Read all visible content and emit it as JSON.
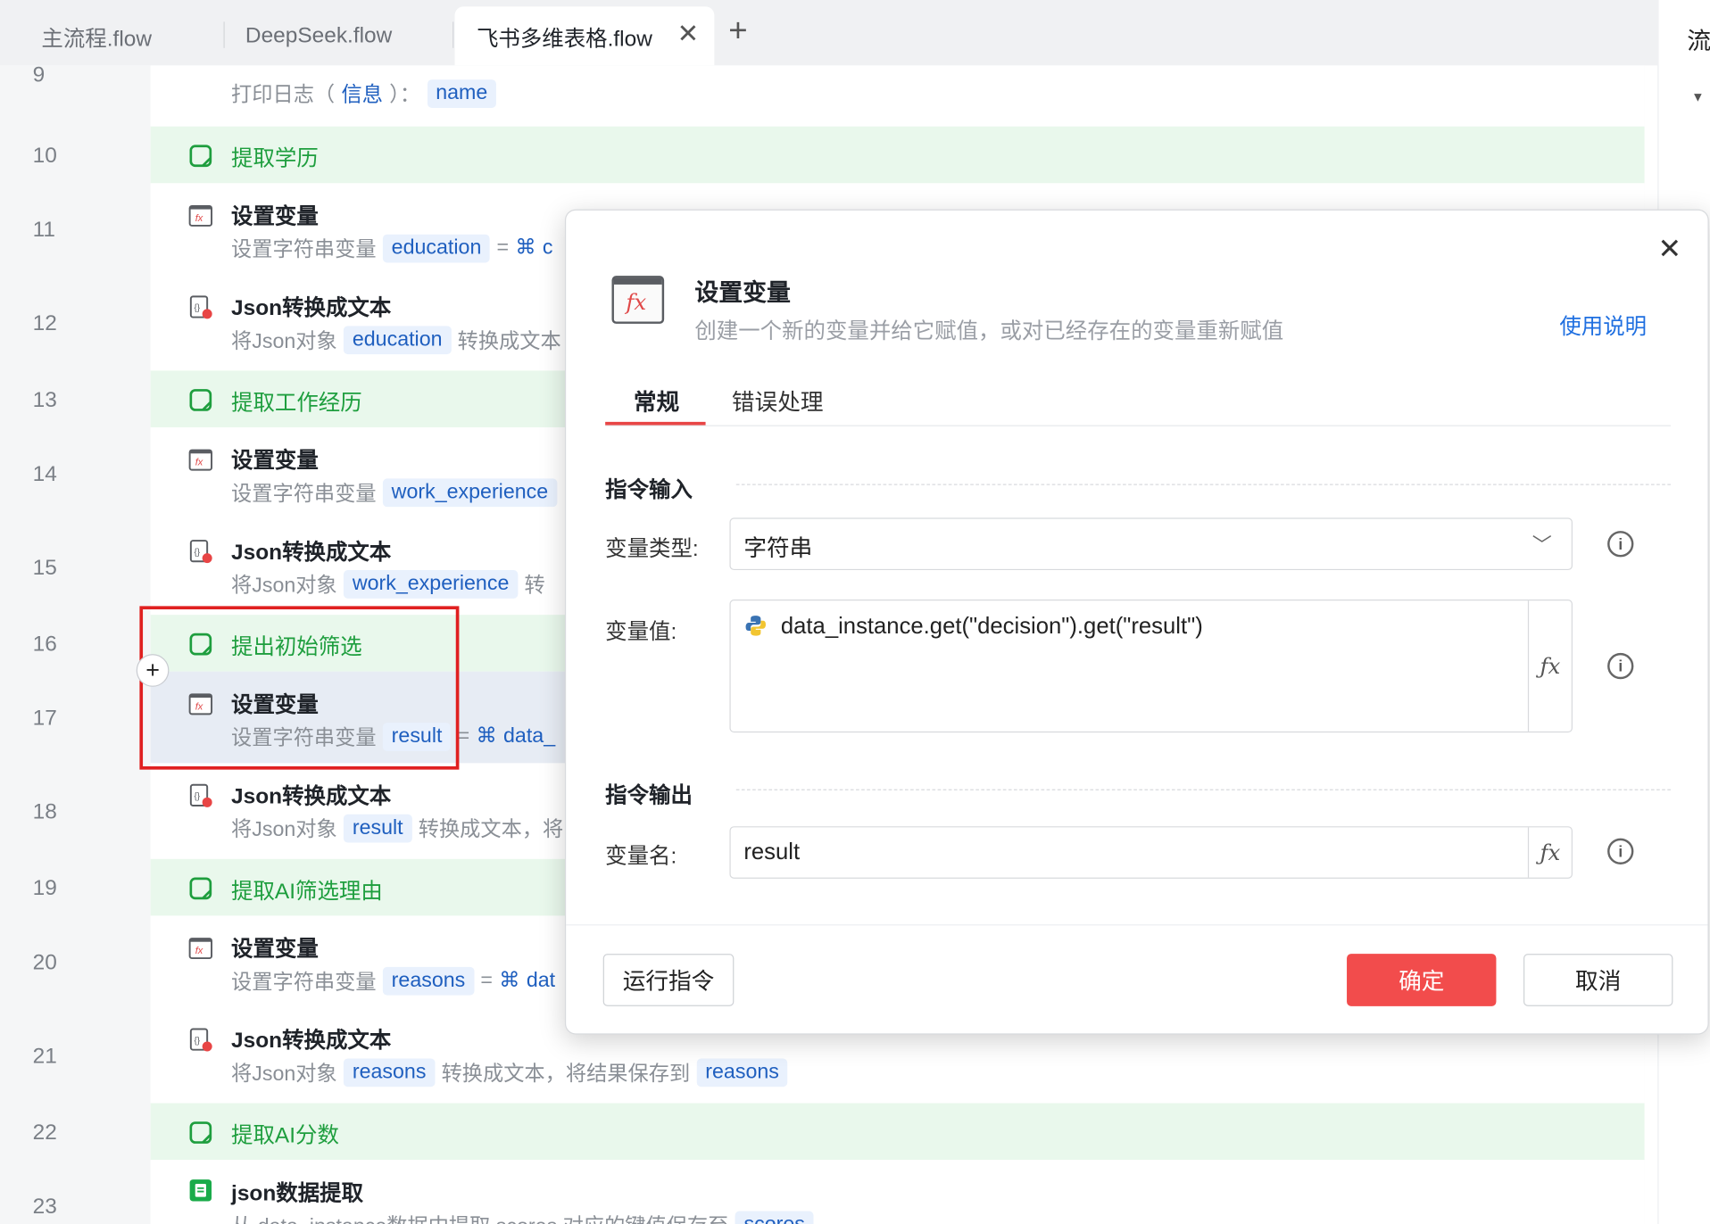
{
  "tabs": [
    {
      "label": "主流程.flow"
    },
    {
      "label": "DeepSeek.flow"
    },
    {
      "label": "飞书多维表格.flow"
    }
  ],
  "right_panel_label": "流",
  "line_numbers": [
    "9",
    "10",
    "11",
    "12",
    "13",
    "14",
    "15",
    "16",
    "17",
    "18",
    "19",
    "20",
    "21",
    "22",
    "23"
  ],
  "rows": {
    "r9": {
      "prefix": "打印日志（",
      "mid": "信息",
      "suffix": "）：",
      "chip": "name"
    },
    "r10": {
      "title": "提取学历"
    },
    "r11": {
      "title": "设置变量",
      "prefix": "设置字符串变量",
      "chip": "education",
      "eq": "=",
      "tail": "c"
    },
    "r12": {
      "title": "Json转换成文本",
      "prefix": "将Json对象",
      "chip": "education",
      "tail": "转换成文本"
    },
    "r13": {
      "title": "提取工作经历"
    },
    "r14": {
      "title": "设置变量",
      "prefix": "设置字符串变量",
      "chip": "work_experience"
    },
    "r15": {
      "title": "Json转换成文本",
      "prefix": "将Json对象",
      "chip": "work_experience",
      "tail": "转"
    },
    "r16": {
      "title": "提出初始筛选"
    },
    "r17": {
      "title": "设置变量",
      "prefix": "设置字符串变量",
      "chip": "result",
      "eq": "=",
      "tail": "data_"
    },
    "r18": {
      "title": "Json转换成文本",
      "prefix": "将Json对象",
      "chip": "result",
      "tail": "转换成文本，将"
    },
    "r19": {
      "title": "提取AI筛选理由"
    },
    "r20": {
      "title": "设置变量",
      "prefix": "设置字符串变量",
      "chip": "reasons",
      "eq": "=",
      "tail": "dat"
    },
    "r21": {
      "title": "Json转换成文本",
      "prefix": "将Json对象",
      "chip": "reasons",
      "tail": "转换成文本，将结果保存到",
      "chip2": "reasons"
    },
    "r22": {
      "title": "提取AI分数"
    },
    "r23": {
      "title": "json数据提取",
      "desc": "从 data_instance数据中提取 scores 对应的键值保存至",
      "chip": "scores"
    }
  },
  "dialog": {
    "title": "设置变量",
    "subtitle": "创建一个新的变量并给它赋值，或对已经存在的变量重新赋值",
    "help": "使用说明",
    "tabs": [
      "常规",
      "错误处理"
    ],
    "input_section": "指令输入",
    "var_type_label": "变量类型:",
    "var_type_value": "字符串",
    "var_value_label": "变量值:",
    "var_value": "data_instance.get(\"decision\").get(\"result\")",
    "output_section": "指令输出",
    "var_name_label": "变量名:",
    "var_name_value": "result",
    "run_button": "运行指令",
    "ok_button": "确定",
    "cancel_button": "取消"
  },
  "colors": {
    "accent_red": "#f24c4c",
    "group_green": "#1e9e3e",
    "chip_blue": "#1f5fbf",
    "link_blue": "#1f6fe0"
  },
  "icons": {
    "fx": "fx-icon",
    "json": "json-convert-icon",
    "group": "note-icon",
    "extract": "sheet-icon",
    "python": "python-icon"
  }
}
